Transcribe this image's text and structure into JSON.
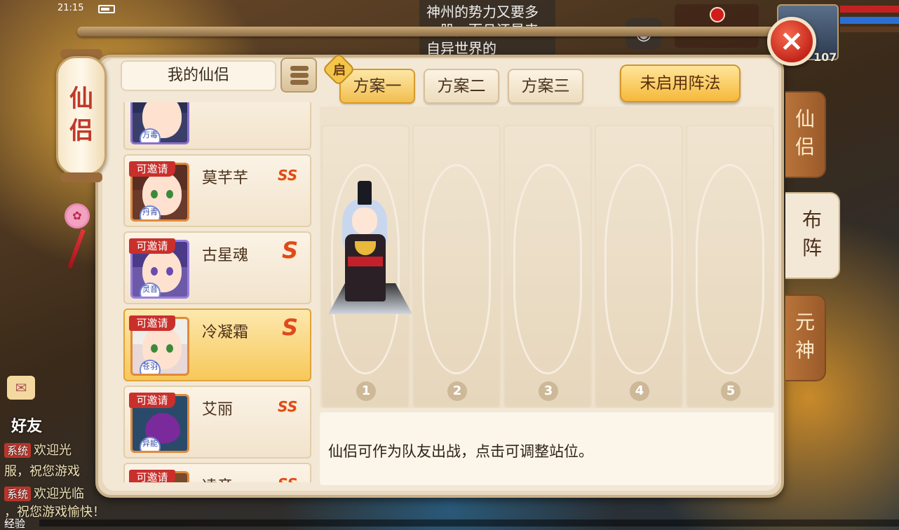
{
  "status_bar": {
    "time": "21:15"
  },
  "background": {
    "chat_banner": "神州的势力又要多一股，而且还是来自异世界的",
    "level": "107",
    "friends_label": "好友",
    "system_messages": [
      {
        "tag": "系统",
        "text": "欢迎光"
      },
      {
        "tag": "",
        "text": "服，祝您游戏"
      },
      {
        "tag": "系统",
        "text": "欢迎光临"
      },
      {
        "tag": "",
        "text": "，祝您游戏愉快！"
      }
    ],
    "exp_label": "经验"
  },
  "lantern": {
    "title": "仙侣"
  },
  "list_header": {
    "title": "我的仙侣"
  },
  "plans": {
    "start_badge": "启",
    "tabs": [
      {
        "label": "方案一",
        "active": true
      },
      {
        "label": "方案二",
        "active": false
      },
      {
        "label": "方案三",
        "active": false
      }
    ],
    "formation_button": "未启用阵法"
  },
  "companions": [
    {
      "name": "",
      "grade": "",
      "class": "万毒",
      "invite": "",
      "selected": false
    },
    {
      "name": "莫芊芊",
      "grade": "SS",
      "class": "丹青",
      "invite": "可邀请",
      "selected": false
    },
    {
      "name": "古星魂",
      "grade": "S",
      "class": "灵音",
      "invite": "可邀请",
      "selected": false
    },
    {
      "name": "冷凝霜",
      "grade": "S",
      "class": "苍羽",
      "invite": "可邀请",
      "selected": true
    },
    {
      "name": "艾丽",
      "grade": "SS",
      "class": "异能",
      "invite": "可邀请",
      "selected": false
    },
    {
      "name": "凌音",
      "grade": "SS",
      "class": "",
      "invite": "可邀请",
      "selected": false
    }
  ],
  "slots": [
    "1",
    "2",
    "3",
    "4",
    "5"
  ],
  "info_text": "仙侣可作为队友出战，点击可调整站位。",
  "side_tabs": [
    {
      "label": "仙侣",
      "active": false
    },
    {
      "label": "布阵",
      "active": true
    },
    {
      "label": "元神",
      "active": false
    }
  ],
  "close_label": "×"
}
